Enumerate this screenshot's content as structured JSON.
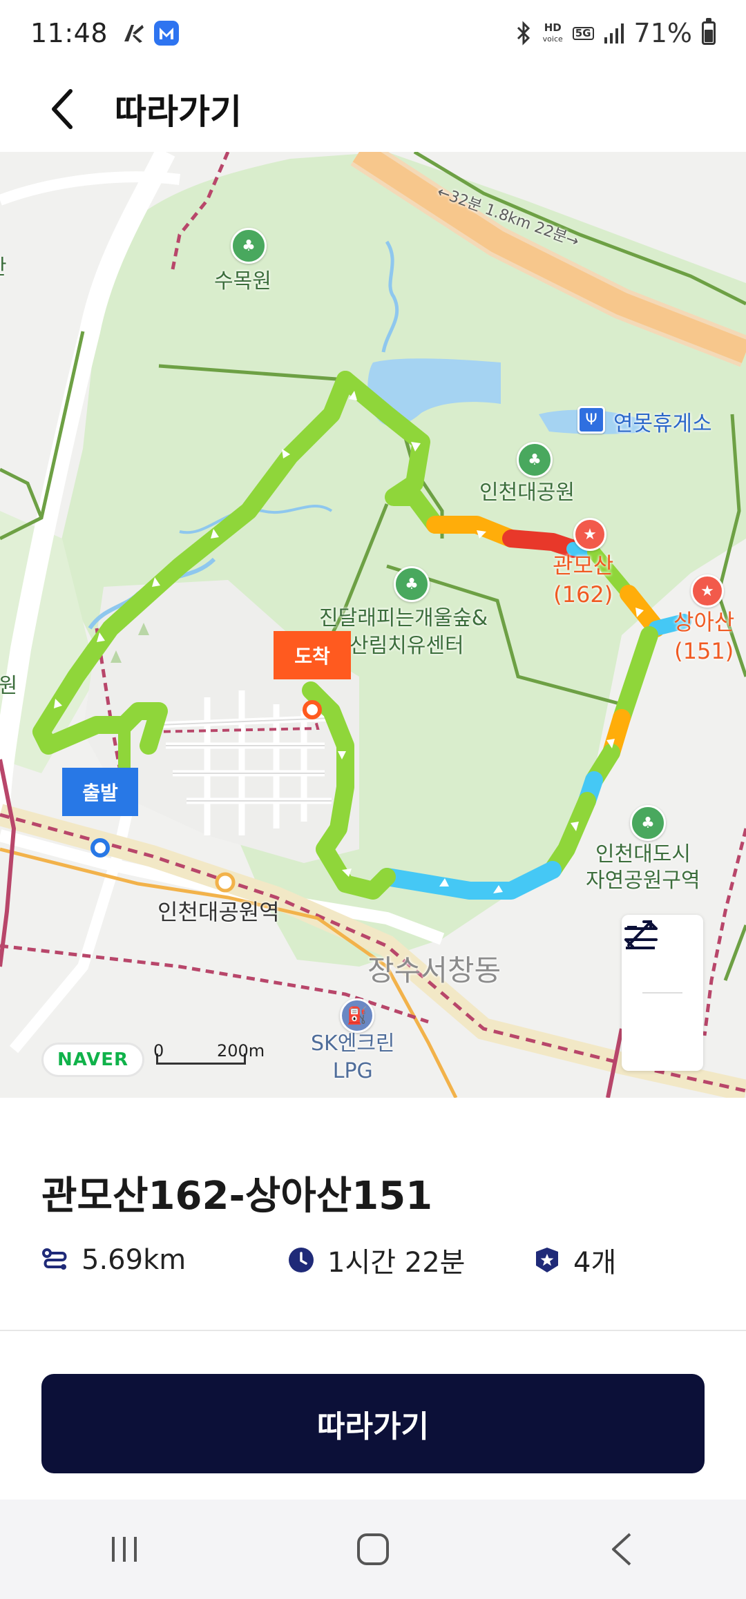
{
  "status_bar": {
    "time": "11:48",
    "battery": "71%",
    "battery_level": 0.71,
    "hd_voice_top": "HD",
    "hd_voice_bottom": "voice",
    "network": "5G"
  },
  "header": {
    "title": "따라가기"
  },
  "map": {
    "labels": {
      "sumogwon": "수목원",
      "rest_area": "연못휴게소",
      "incheon_park": "인천대공원",
      "gwanmosan": "관모산\n(162)",
      "sangasan": "상아산\n(151)",
      "forest_center_line1": "진달래피는개울숲&",
      "forest_center_line2": "산림치유센터",
      "city_park_line1": "인천대도시",
      "city_park_line2": "자연공원구역",
      "station": "인천대공원역",
      "district": "장수서창동",
      "lpg": "SK엔크린\nLPG",
      "edge_left_top": "산",
      "edge_left_mid": "공원",
      "road_time": "←32분 1.8km 22분→"
    },
    "start_flag": "출발",
    "end_flag": "도착",
    "naver_logo": "NAVER",
    "scale_zero": "0",
    "scale_label": "200m",
    "colors": {
      "route_green": "#8fd63a",
      "route_orange": "#ffad0a",
      "route_red": "#e8382a",
      "route_blue": "#45c8f5",
      "park": "#d9edcc",
      "water": "#a5d3f2",
      "road_orange": "#f7c78c",
      "rail": "#b8466a"
    }
  },
  "course": {
    "title": "관모산162-상아산151",
    "distance": "5.69km",
    "duration": "1시간 22분",
    "peaks": "4개"
  },
  "primary_button": {
    "label": "따라가기"
  },
  "icons": {
    "back": "chevron-left-icon",
    "elevation": "elevation-toggle-icon",
    "swap": "swap-direction-icon",
    "distance": "route-distance-icon",
    "time": "clock-icon",
    "peak": "peak-badge-icon"
  }
}
